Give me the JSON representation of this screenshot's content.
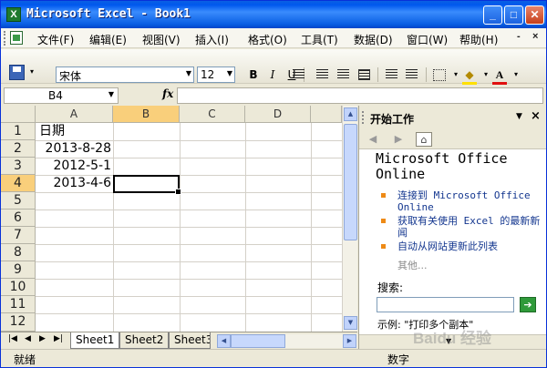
{
  "window": {
    "title": "Microsoft Excel - Book1",
    "app_icon": "X",
    "controls": {
      "minimize": "_",
      "maximize": "□",
      "close": "✕"
    }
  },
  "menu": {
    "items": [
      "文件(F)",
      "编辑(E)",
      "视图(V)",
      "插入(I)",
      "格式(O)",
      "工具(T)",
      "数据(D)",
      "窗口(W)",
      "帮助(H)"
    ],
    "doc_controls": [
      "-",
      "×"
    ]
  },
  "toolbar": {
    "font": "宋体",
    "size": "12",
    "bold": "B",
    "italic": "I",
    "underline": "U",
    "fill_icon": "fill-color-icon",
    "font_color": "A"
  },
  "formula_bar": {
    "name_box": "B4",
    "fx": "fx",
    "formula": ""
  },
  "grid": {
    "columns": [
      "A",
      "B",
      "C",
      "D"
    ],
    "rows": [
      "1",
      "2",
      "3",
      "4",
      "5",
      "6",
      "7",
      "8",
      "9",
      "10",
      "11",
      "12"
    ],
    "cells": {
      "A1": "日期",
      "A2": "2013-8-28",
      "A3": "2012-5-1",
      "A4": "2013-4-6"
    },
    "selected": "B4"
  },
  "sheets": [
    "Sheet1",
    "Sheet2",
    "Sheet3"
  ],
  "task_pane": {
    "title": "开始工作",
    "online_title": "Microsoft Office Online",
    "links": [
      "连接到 Microsoft Office Online",
      "获取有关使用 Excel 的最新新闻",
      "自动从网站更新此列表"
    ],
    "more": "其他...",
    "search_label": "搜索:",
    "example": "示例: \"打印多个副本\""
  },
  "status": {
    "ready": "就绪",
    "mode": "数字"
  },
  "watermark": "Baidu 经验",
  "colors": {
    "title_bar": "#0a5fe3",
    "selection": "#000000",
    "link": "#13368f",
    "bullet": "#ee8a16"
  }
}
